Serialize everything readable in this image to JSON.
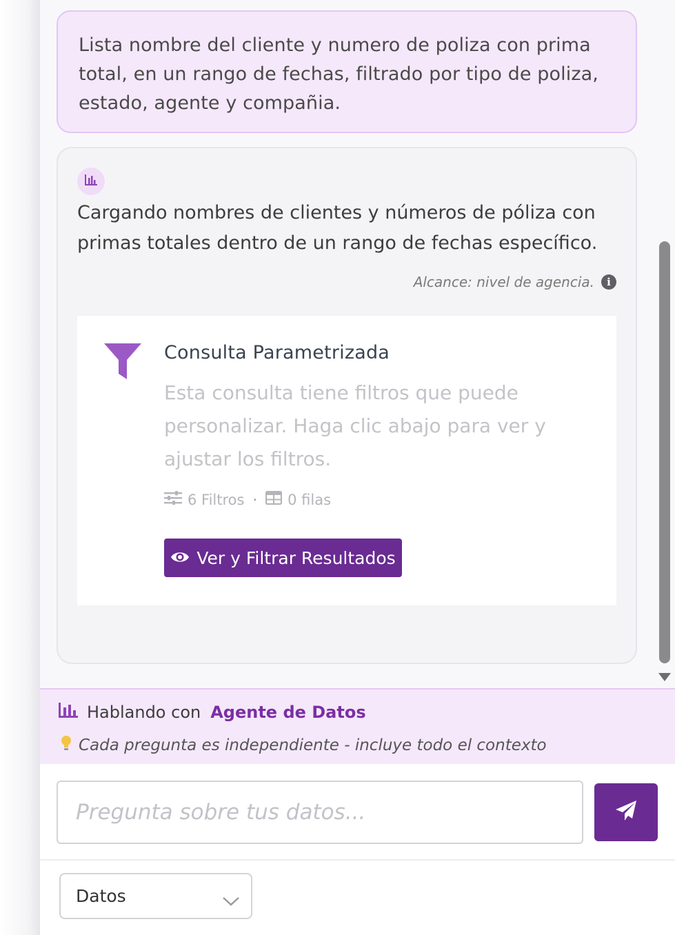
{
  "user_message": {
    "text": "Lista nombre del cliente y numero de poliza con prima total, en un rango de fechas, filtrado por tipo de poliza, estado, agente y compañia."
  },
  "bot_message": {
    "avatar_icon": "bar-chart-icon",
    "text": "Cargando nombres de clientes y números de póliza con primas totales dentro de un rango de fechas específico.",
    "scope": "Alcance: nivel de agencia.",
    "card": {
      "icon": "funnel-icon",
      "title": "Consulta Parametrizada",
      "description": "Esta consulta tiene filtros que puede personalizar. Haga clic abajo para ver y ajustar los filtros.",
      "filters_count": "6 Filtros",
      "separator": "·",
      "rows_count": "0 filas",
      "button_label": "Ver y Filtrar Resultados"
    }
  },
  "agent_bar": {
    "prefix": "Hablando con",
    "agent_name": "Agente de Datos",
    "tip": "Cada pregunta es independiente - incluye todo el contexto"
  },
  "input": {
    "placeholder": "Pregunta sobre tus datos...",
    "value": ""
  },
  "mode_select": {
    "selected": "Datos"
  },
  "colors": {
    "accent": "#6a2b93",
    "accent_light": "#f5e8fb",
    "funnel": "#9b59c6",
    "agent_name": "#7b2fa3"
  }
}
